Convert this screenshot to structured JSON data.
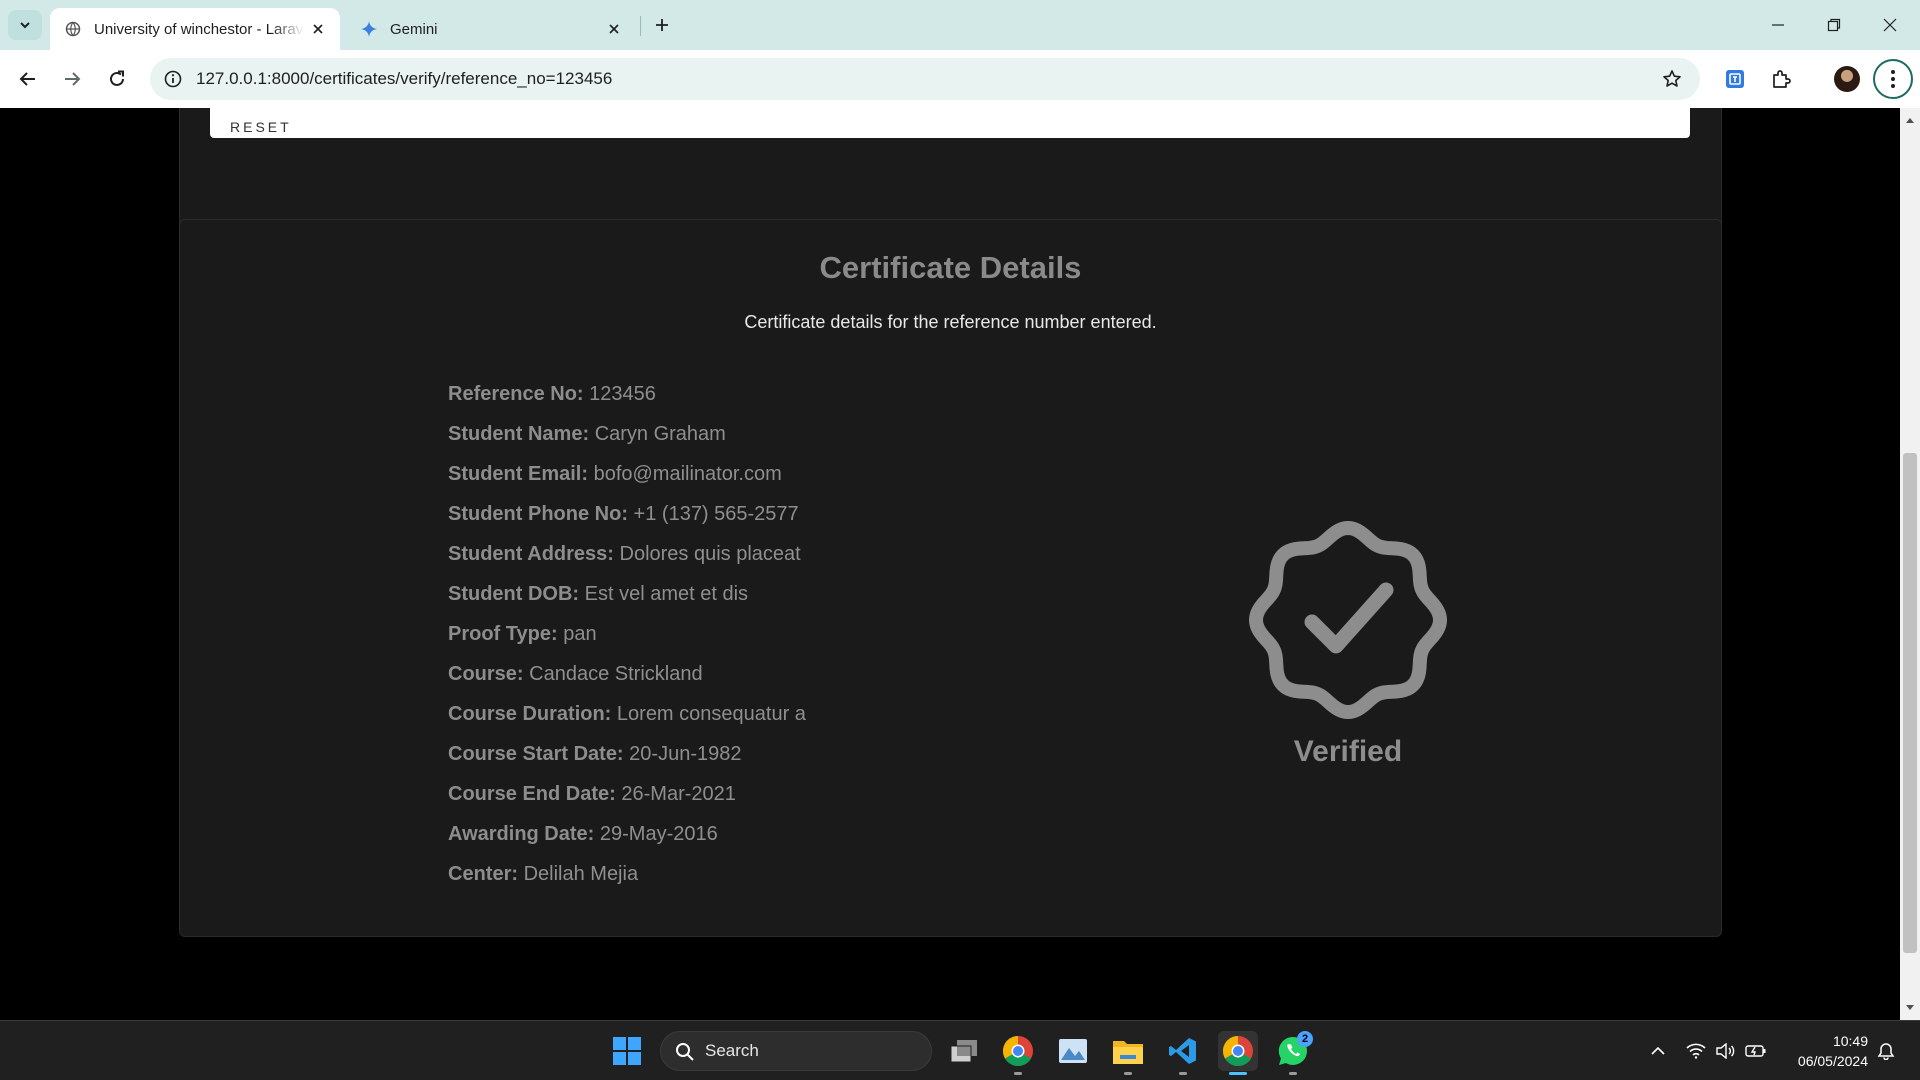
{
  "browser": {
    "tabs": [
      {
        "title": "University of winchestor - Larav",
        "active": true
      },
      {
        "title": "Gemini",
        "active": false
      }
    ],
    "url": "127.0.0.1:8000/certificates/verify/reference_no=123456"
  },
  "form": {
    "reset_label": "RESET"
  },
  "certificate": {
    "title": "Certificate Details",
    "subtitle": "Certificate details for the reference number entered.",
    "fields": [
      {
        "label": "Reference No:",
        "value": "123456"
      },
      {
        "label": "Student Name:",
        "value": "Caryn Graham"
      },
      {
        "label": "Student Email:",
        "value": "bofo@mailinator.com"
      },
      {
        "label": "Student Phone No:",
        "value": "+1 (137) 565-2577"
      },
      {
        "label": "Student Address:",
        "value": "Dolores quis placeat"
      },
      {
        "label": "Student DOB:",
        "value": "Est vel amet et dis"
      },
      {
        "label": "Proof Type:",
        "value": "pan"
      },
      {
        "label": "Course:",
        "value": "Candace Strickland"
      },
      {
        "label": "Course Duration:",
        "value": "Lorem consequatur a"
      },
      {
        "label": "Course Start Date:",
        "value": "20-Jun-1982"
      },
      {
        "label": "Course End Date:",
        "value": "26-Mar-2021"
      },
      {
        "label": "Awarding Date:",
        "value": "29-May-2016"
      },
      {
        "label": "Center:",
        "value": "Delilah Mejia"
      }
    ],
    "status": "Verified"
  },
  "taskbar": {
    "search_label": "Search",
    "whatsapp_badge": "2",
    "time": "10:49",
    "date": "06/05/2024"
  },
  "colors": {
    "page_background": "#000000",
    "card_background": "#1a1a1b",
    "accent_teal": "#d3e9e8",
    "badge_gray": "#8d8d8d"
  }
}
